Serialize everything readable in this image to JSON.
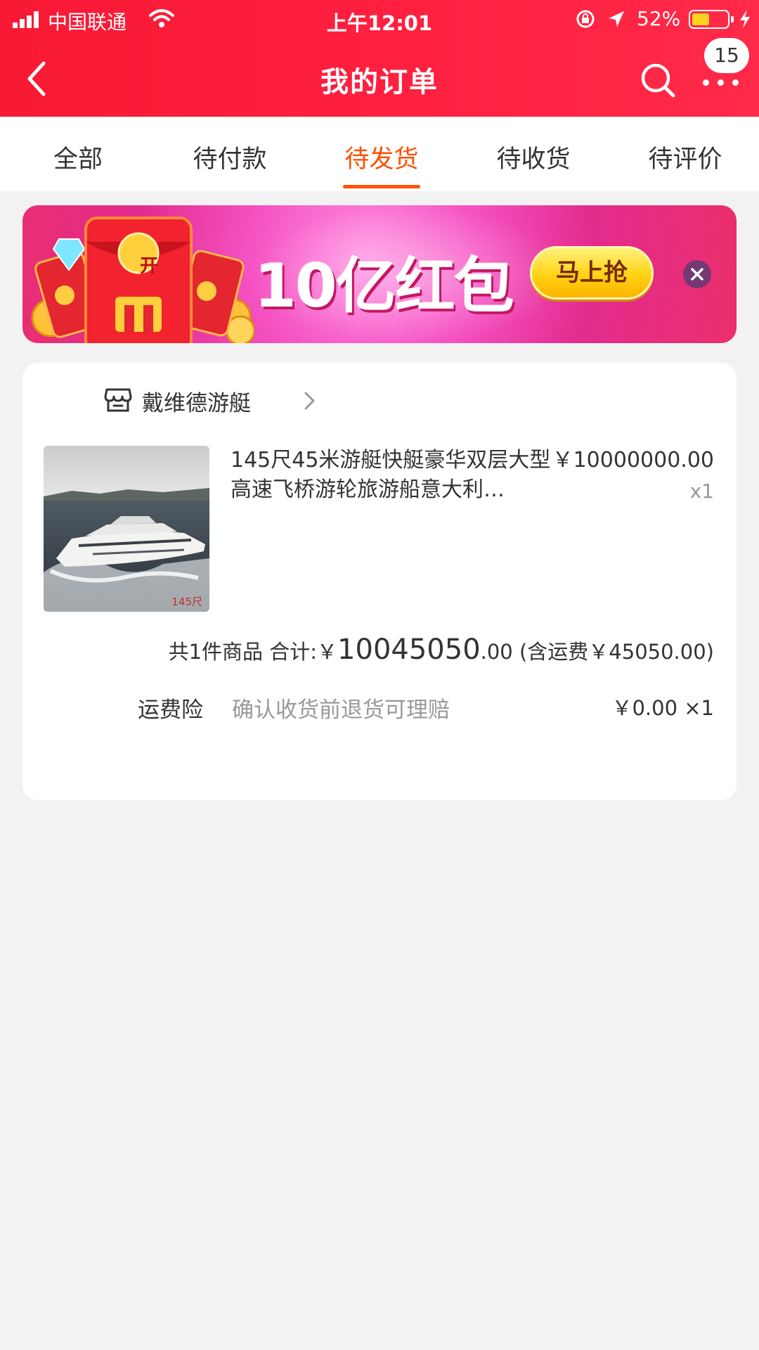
{
  "status_bar": {
    "carrier": "中国联通",
    "time": "上午12:01",
    "battery_percent": "52%",
    "battery_level": 0.52
  },
  "nav": {
    "title": "我的订单",
    "badge_count": "15"
  },
  "tabs": [
    {
      "label": "全部",
      "active": false
    },
    {
      "label": "待付款",
      "active": false
    },
    {
      "label": "待发货",
      "active": true
    },
    {
      "label": "待收货",
      "active": false
    },
    {
      "label": "待评价",
      "active": false
    }
  ],
  "banner": {
    "open_label": "开",
    "title": "10亿红包",
    "button_label": "马上抢"
  },
  "order": {
    "shop_name": "戴维德游艇",
    "product": {
      "title": "145尺45米游艇快艇豪华双层大型高速飞桥游轮旅游船意大利…",
      "price": "￥10000000.00",
      "quantity": "x1",
      "image_caption": "145尺"
    },
    "summary": {
      "count_text": "共1件商品",
      "total_label": "合计:",
      "currency": "￥",
      "total_integer": "10045050",
      "total_decimal": ".00",
      "shipping_text": "(含运费￥45050.00)"
    },
    "insurance": {
      "label": "运费险",
      "description": "确认收货前退货可理赔",
      "price": "￥0.00 ×1"
    }
  },
  "colors": {
    "header_red": "#ff1f3f",
    "tab_active": "#ff5000",
    "banner_pink": "#f552c3",
    "button_yellow": "#ffd214"
  }
}
